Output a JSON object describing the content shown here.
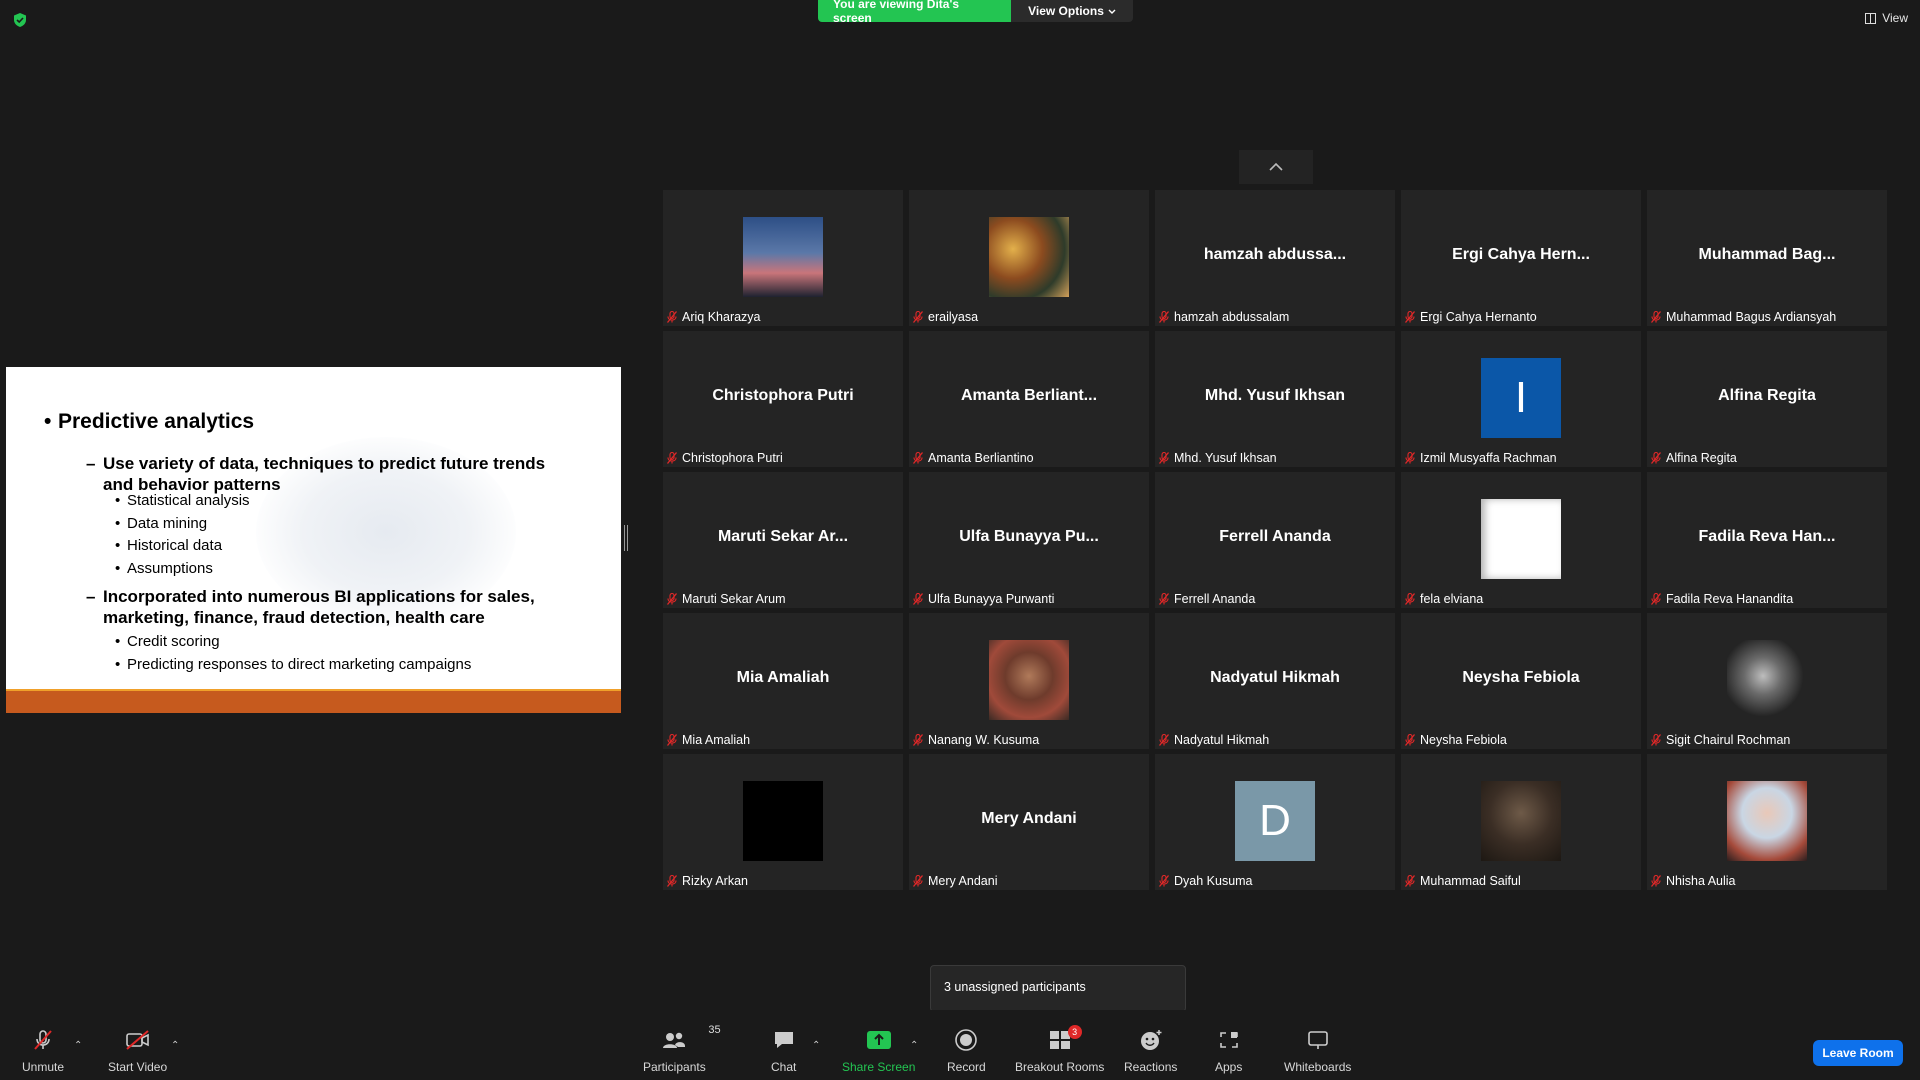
{
  "top_bar": {
    "viewing_label": "You are viewing Dita's screen",
    "view_options_label": "View Options",
    "view_label": "View"
  },
  "slide": {
    "bullet1": "Predictive analytics",
    "sub1": "Use variety of data, techniques to predict future trends and behavior patterns",
    "sub1_items": [
      "Statistical analysis",
      "Data mining",
      "Historical data",
      "Assumptions"
    ],
    "sub2": "Incorporated into numerous BI applications for sales, marketing, finance, fraud detection, health care",
    "sub2_items": [
      "Credit scoring",
      "Predicting responses to direct marketing campaigns"
    ]
  },
  "participants": [
    {
      "name": "Ariq Kharazya",
      "display": "",
      "avatar": "sunset"
    },
    {
      "name": "erailyasa",
      "display": "",
      "avatar": "painting"
    },
    {
      "name": "hamzah abdussalam",
      "display": "hamzah abdussa...",
      "avatar": ""
    },
    {
      "name": "Ergi Cahya Hernanto",
      "display": "Ergi Cahya Hern...",
      "avatar": ""
    },
    {
      "name": "Muhammad Bagus Ardiansyah",
      "display": "Muhammad Bag...",
      "avatar": ""
    },
    {
      "name": "Christophora Putri",
      "display": "Christophora Putri",
      "avatar": ""
    },
    {
      "name": "Amanta Berliantino",
      "display": "Amanta Berliant...",
      "avatar": ""
    },
    {
      "name": "Mhd. Yusuf Ikhsan",
      "display": "Mhd. Yusuf Ikhsan",
      "avatar": ""
    },
    {
      "name": "Izmil Musyaffa Rachman",
      "display": "",
      "avatar": "initial",
      "initial": "I",
      "color": "#0b57a8"
    },
    {
      "name": "Alfina Regita",
      "display": "Alfina Regita",
      "avatar": ""
    },
    {
      "name": "Maruti Sekar Arum",
      "display": "Maruti Sekar Ar...",
      "avatar": ""
    },
    {
      "name": "Ulfa Bunayya Purwanti",
      "display": "Ulfa Bunayya Pu...",
      "avatar": ""
    },
    {
      "name": "Ferrell Ananda",
      "display": "Ferrell Ananda",
      "avatar": ""
    },
    {
      "name": "fela elviana",
      "display": "",
      "avatar": "white"
    },
    {
      "name": "Fadila Reva Hanandita",
      "display": "Fadila Reva Han...",
      "avatar": ""
    },
    {
      "name": "Mia Amaliah",
      "display": "Mia Amaliah",
      "avatar": ""
    },
    {
      "name": "Nanang W. Kusuma",
      "display": "",
      "avatar": "photo-person"
    },
    {
      "name": "Nadyatul Hikmah",
      "display": "Nadyatul Hikmah",
      "avatar": ""
    },
    {
      "name": "Neysha Febiola",
      "display": "Neysha Febiola",
      "avatar": ""
    },
    {
      "name": "Sigit Chairul Rochman",
      "display": "",
      "avatar": "sketch"
    },
    {
      "name": "Rizky Arkan",
      "display": "",
      "avatar": "black"
    },
    {
      "name": "Mery Andani",
      "display": "Mery Andani",
      "avatar": ""
    },
    {
      "name": "Dyah Kusuma",
      "display": "",
      "avatar": "initial",
      "initial": "D",
      "color": "#7a98a8"
    },
    {
      "name": "Muhammad Saiful",
      "display": "",
      "avatar": "photo-dark"
    },
    {
      "name": "Nhisha Aulia",
      "display": "",
      "avatar": "photo-hijab"
    }
  ],
  "tooltip": {
    "unassigned": "3 unassigned participants"
  },
  "toolbar": {
    "unmute": "Unmute",
    "start_video": "Start Video",
    "participants": "Participants",
    "participants_count": "35",
    "chat": "Chat",
    "share_screen": "Share Screen",
    "record": "Record",
    "breakout_rooms": "Breakout Rooms",
    "breakout_badge": "3",
    "reactions": "Reactions",
    "apps": "Apps",
    "whiteboards": "Whiteboards",
    "leave_room": "Leave Room"
  },
  "colors": {
    "accent_green": "#23c552",
    "leave_blue": "#0e71eb",
    "muted_red": "#e02828"
  }
}
